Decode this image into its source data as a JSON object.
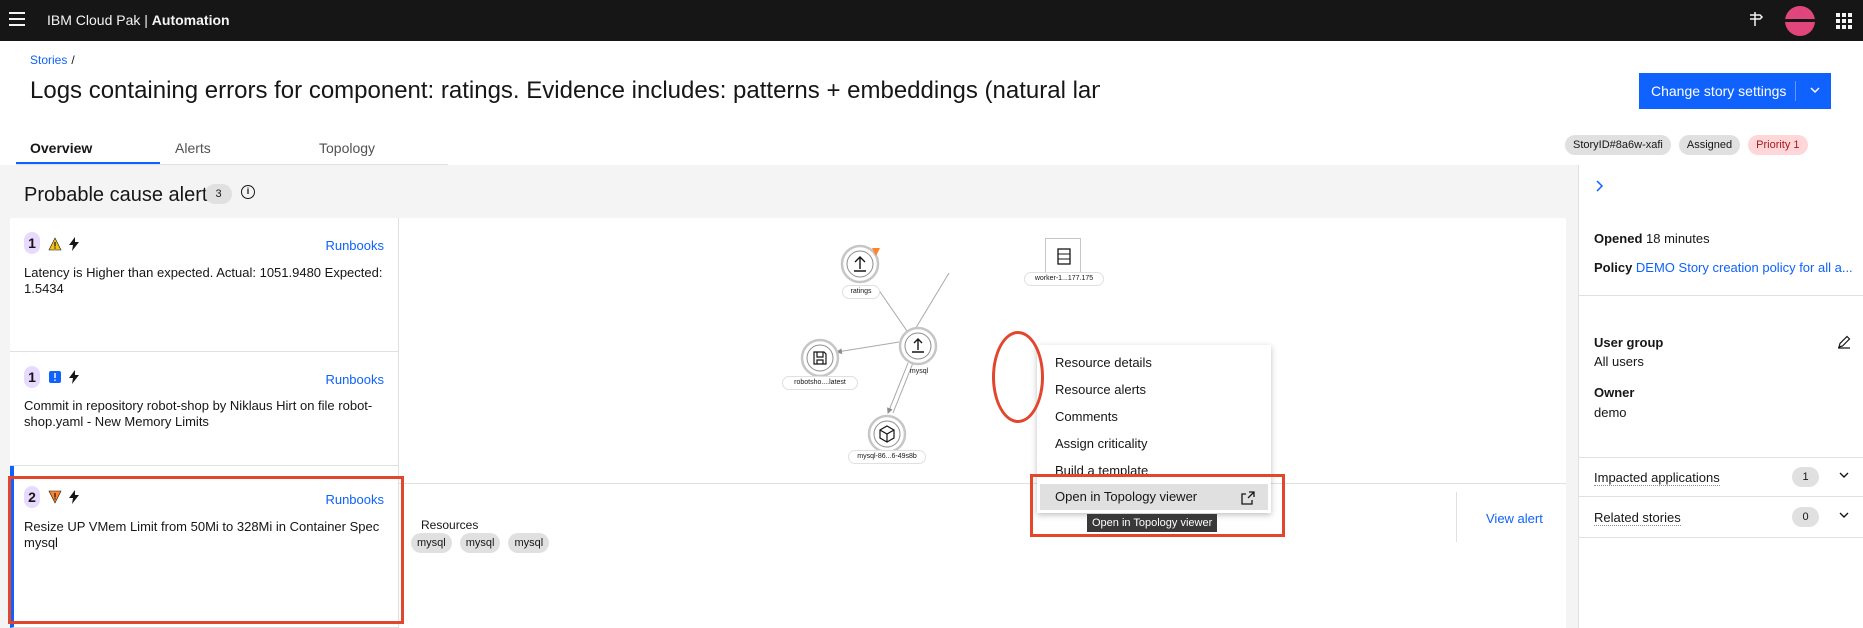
{
  "topbar": {
    "brand_prefix": "IBM Cloud Pak | ",
    "brand_product": "Automation"
  },
  "header": {
    "breadcrumb_link": "Stories",
    "breadcrumb_sep": "/",
    "title": "Logs containing errors for component: ratings. Evidence includes: patterns + embeddings (natural language)",
    "change_button": "Change story settings",
    "tabs": [
      "Overview",
      "Alerts",
      "Topology"
    ],
    "tags": {
      "story_id": "StoryID#8a6w-xafi",
      "status": "Assigned",
      "priority": "Priority 1"
    }
  },
  "probable_cause": {
    "title": "Probable cause alerts",
    "count": "3",
    "alerts": [
      {
        "rank": "1",
        "severity": "warning",
        "runbooks": "Runbooks",
        "description": "Latency is Higher than expected. Actual: 1051.9480 Expected: 1.5434"
      },
      {
        "rank": "1",
        "severity": "info",
        "runbooks": "Runbooks",
        "description": "Commit in repository robot-shop by Niklaus Hirt on file robot-shop.yaml - New Memory Limits"
      },
      {
        "rank": "2",
        "severity": "minor",
        "runbooks": "Runbooks",
        "description": "Resize UP VMem Limit from 50Mi to 328Mi in Container Spec mysql"
      }
    ]
  },
  "topology": {
    "nodes": {
      "ratings": "ratings",
      "worker": "worker-1...177.175",
      "robotshop": "robotsho....latest",
      "mysql": "mysql",
      "mysql_pod": "mysql-86...6-49s8b"
    },
    "menu": [
      "Resource details",
      "Resource alerts",
      "Comments",
      "Assign criticality",
      "Build a template",
      "Open in Topology viewer"
    ],
    "tooltip": "Open in Topology viewer"
  },
  "resources": {
    "label": "Resources",
    "tags": [
      "mysql",
      "mysql",
      "mysql"
    ],
    "view_alert": "View alert"
  },
  "right_panel": {
    "opened_label": "Opened",
    "opened_value": "18 minutes",
    "policy_label": "Policy",
    "policy_value": "DEMO Story creation policy for all a...",
    "user_group_label": "User group",
    "user_group_value": "All users",
    "owner_label": "Owner",
    "owner_value": "demo",
    "impacted_label": "Impacted applications",
    "impacted_count": "1",
    "related_label": "Related stories",
    "related_count": "0"
  },
  "colors": {
    "accent": "#0f62fe",
    "highlight": "#e2462c",
    "topbar": "#161616",
    "priority_bg": "#ffd7d9",
    "rank_bg": "#e8daff"
  }
}
